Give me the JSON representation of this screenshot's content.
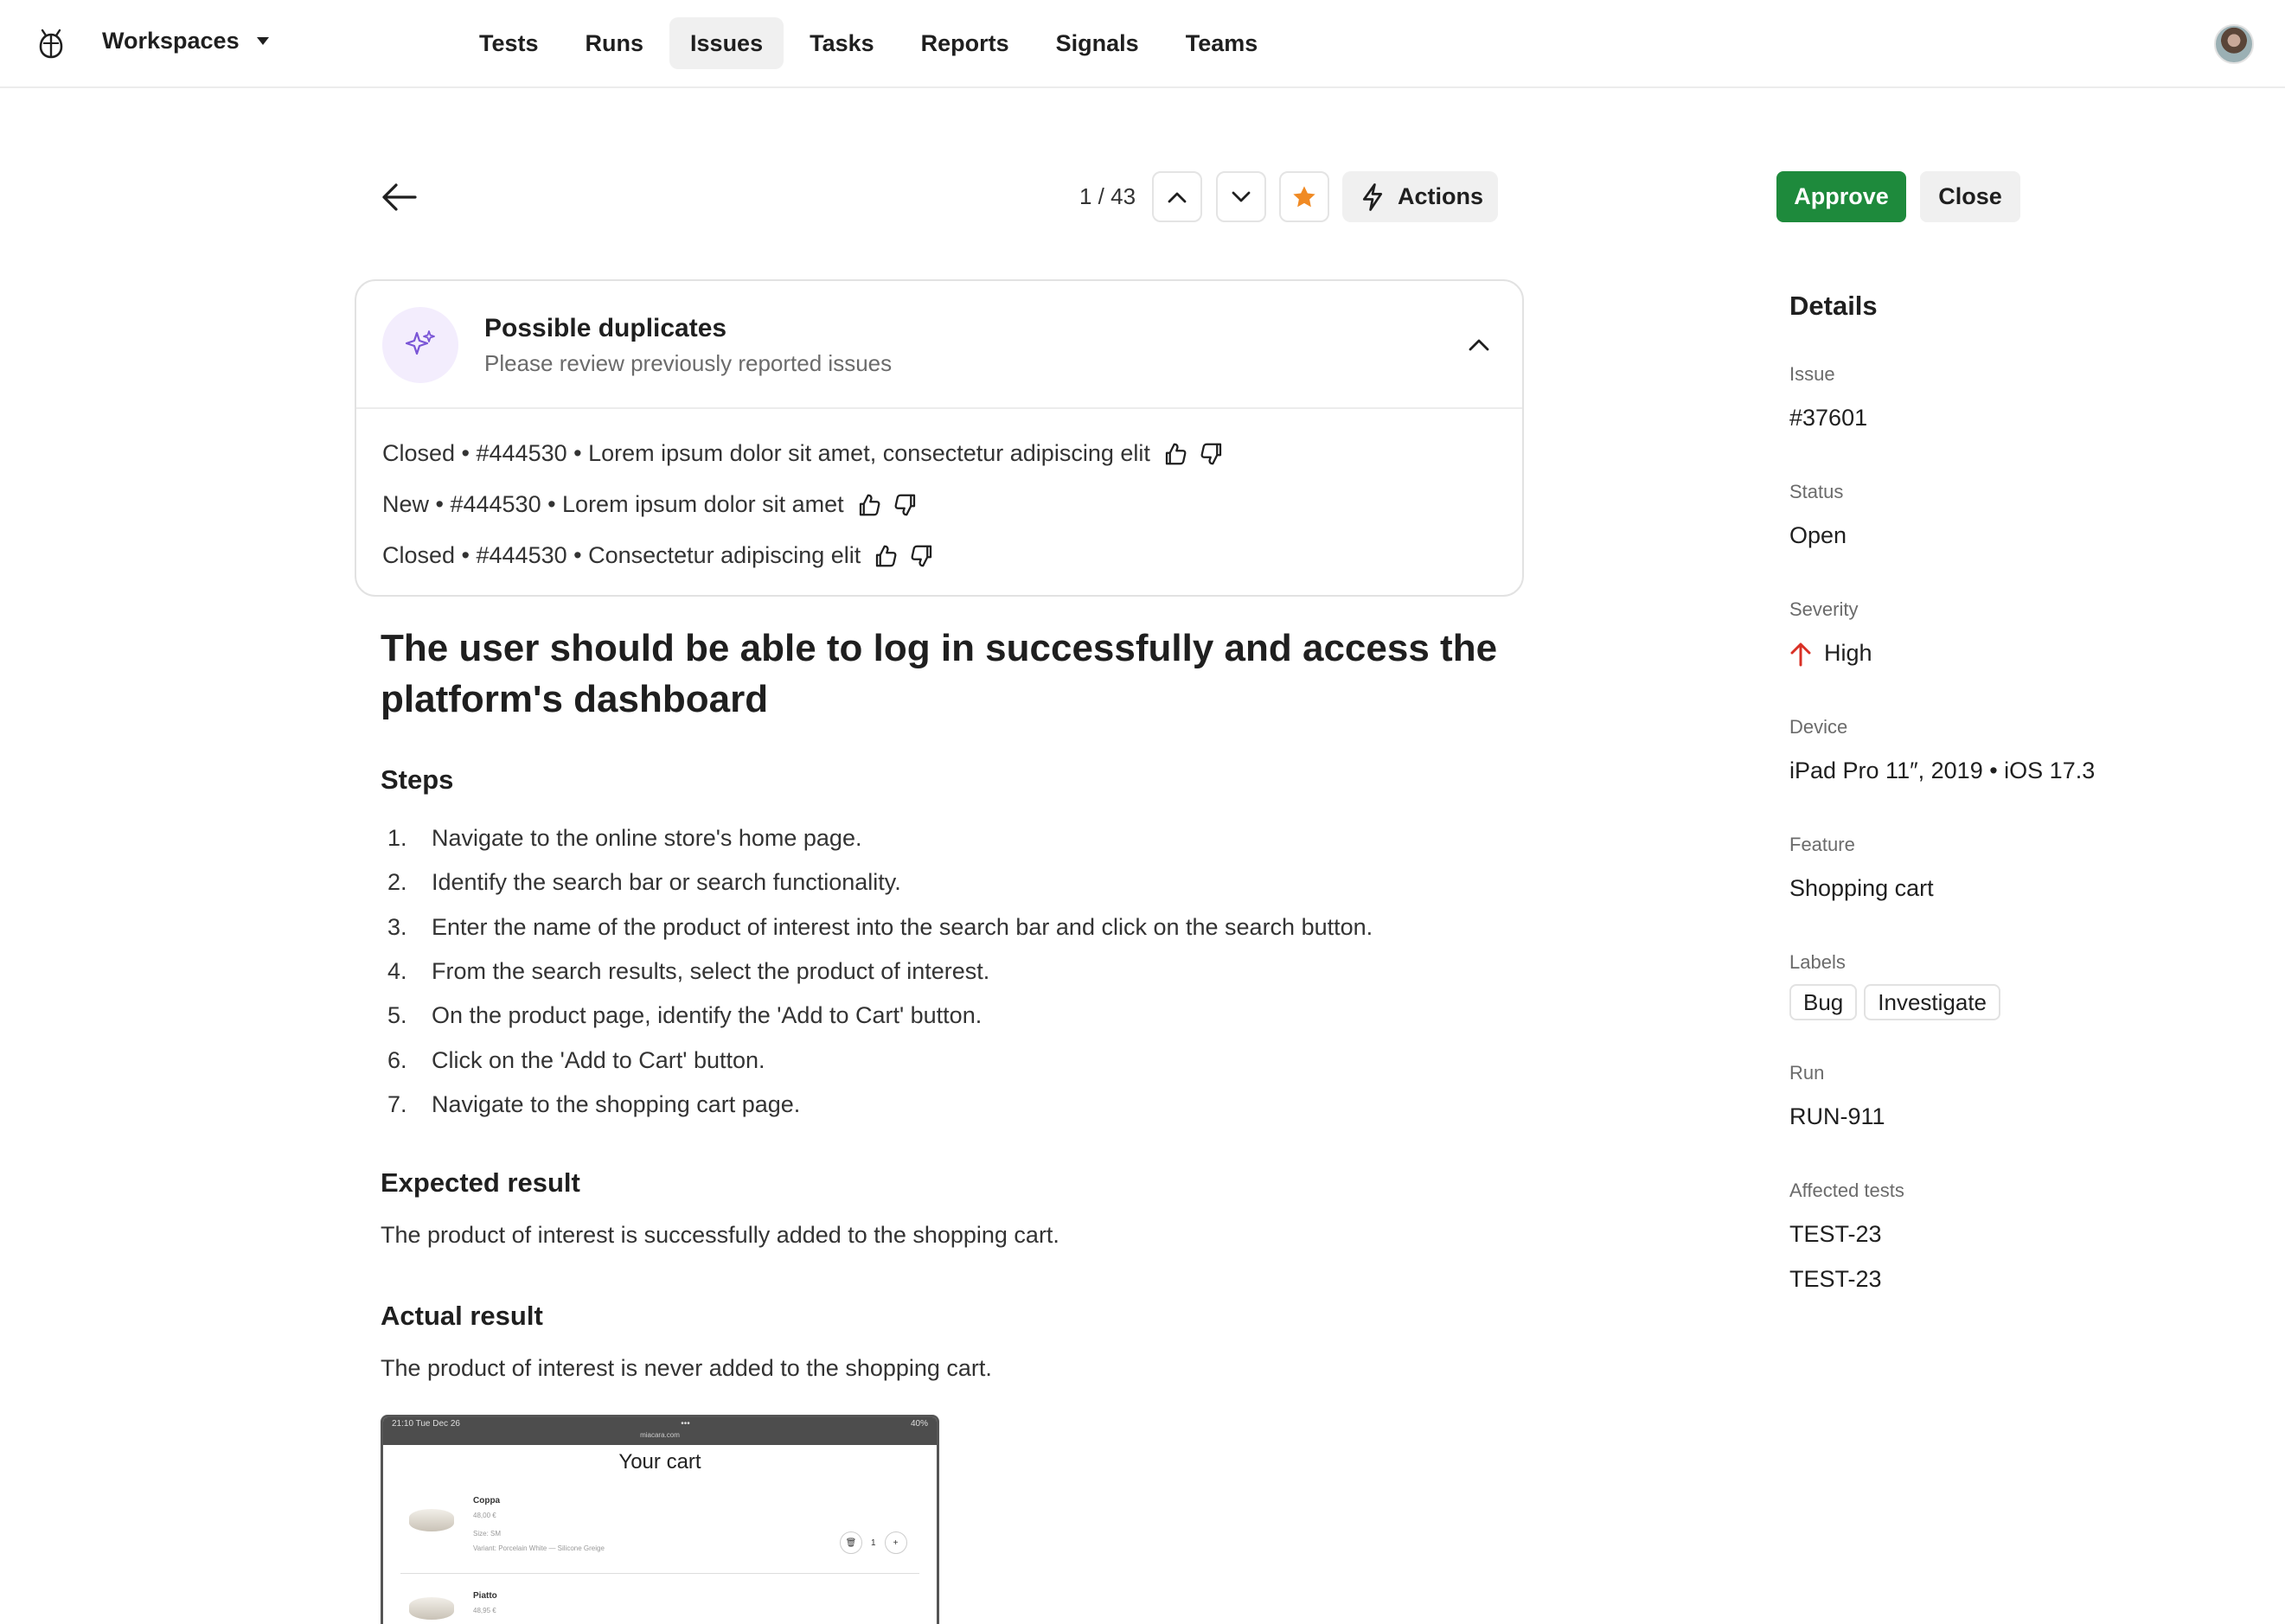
{
  "nav": {
    "workspace_label": "Workspaces",
    "items": [
      {
        "label": "Tests",
        "active": false
      },
      {
        "label": "Runs",
        "active": false
      },
      {
        "label": "Issues",
        "active": true
      },
      {
        "label": "Tasks",
        "active": false
      },
      {
        "label": "Reports",
        "active": false
      },
      {
        "label": "Signals",
        "active": false
      },
      {
        "label": "Teams",
        "active": false
      }
    ]
  },
  "toolbar": {
    "counter": "1 / 43",
    "actions_label": "Actions",
    "approve_label": "Approve",
    "close_label": "Close",
    "star_color": "#f08a24"
  },
  "duplicates": {
    "title": "Possible duplicates",
    "subtitle": "Please review previously reported issues",
    "items": [
      {
        "text": "Closed • #444530 • Lorem ipsum dolor sit amet, consectetur adipiscing elit"
      },
      {
        "text": "New • #444530 • Lorem ipsum dolor sit amet"
      },
      {
        "text": "Closed • #444530 • Consectetur adipiscing elit"
      }
    ]
  },
  "issue": {
    "title": "The user should be able to log in successfully and access the platform's dashboard",
    "steps_heading": "Steps",
    "steps": [
      {
        "num": "1.",
        "text": "Navigate to the online store's home page."
      },
      {
        "num": "2.",
        "text": "Identify the search bar or search functionality."
      },
      {
        "num": "3.",
        "text": "Enter the name of the product of interest into the search bar and click on the search button."
      },
      {
        "num": "4.",
        "text": "From the search results, select the product of interest."
      },
      {
        "num": "5.",
        "text": "On the product page, identify the 'Add to Cart' button."
      },
      {
        "num": "6.",
        "text": "Click on the 'Add to Cart' button."
      },
      {
        "num": "7.",
        "text": "Navigate to the shopping cart page."
      }
    ],
    "expected_heading": "Expected result",
    "expected_text": "The product of interest is successfully added to the shopping cart.",
    "actual_heading": "Actual result",
    "actual_text": "The product of interest is never added to the shopping cart."
  },
  "attachment": {
    "status_time": "21:10  Tue Dec 26",
    "status_dots": "•••",
    "status_right": "40%",
    "url": "miacara.com",
    "title": "Your cart",
    "item1_name": "Coppa",
    "item1_price": "48,00 €",
    "item1_size": "Size: SM",
    "item1_variant": "Variant: Porcelain White — Silicone Greige",
    "item1_qty": "1",
    "item2_name": "Piatto",
    "item2_price": "48,95 €"
  },
  "details": {
    "heading": "Details",
    "issue_label": "Issue",
    "issue_value": "#37601",
    "status_label": "Status",
    "status_value": "Open",
    "severity_label": "Severity",
    "severity_value": "High",
    "severity_color": "#d93025",
    "device_label": "Device",
    "device_value": "iPad Pro 11″, 2019 • iOS 17.3",
    "feature_label": "Feature",
    "feature_value": "Shopping cart",
    "labels_label": "Labels",
    "labels": [
      "Bug",
      "Investigate"
    ],
    "run_label": "Run",
    "run_value": "RUN-911",
    "affected_label": "Affected tests",
    "affected_tests": [
      "TEST-23",
      "TEST-23"
    ]
  }
}
